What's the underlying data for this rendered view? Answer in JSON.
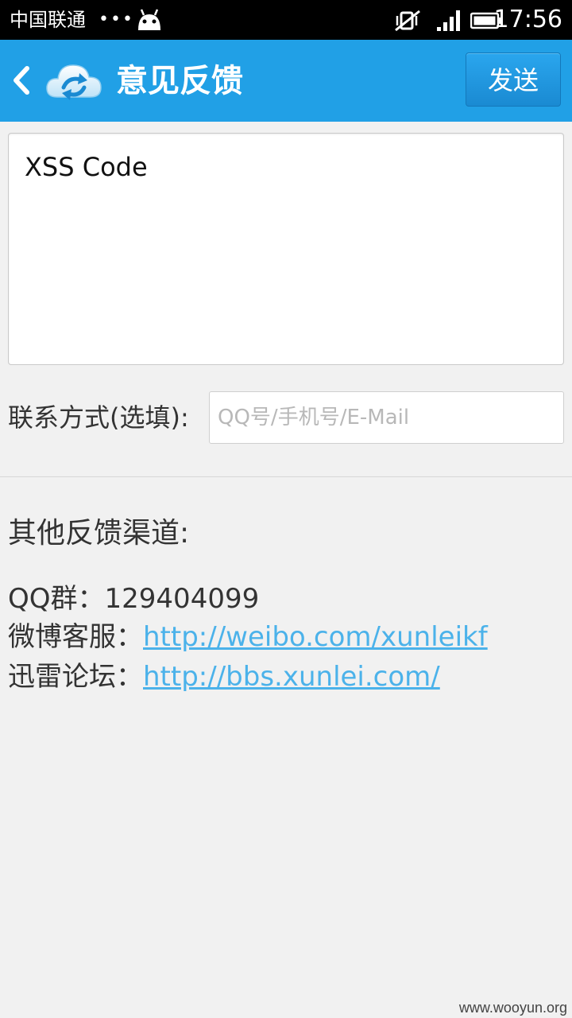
{
  "status_bar": {
    "carrier": "中国联通",
    "dots": "•••",
    "time": "17:56"
  },
  "title_bar": {
    "back_icon": "chevron-left-icon",
    "logo_icon": "cloud-refresh-icon",
    "title": "意见反馈",
    "send_label": "发送",
    "color": "#21a0e6"
  },
  "feedback": {
    "text": "XSS Code"
  },
  "contact": {
    "label": "联系方式(选填):",
    "placeholder": "QQ号/手机号/E-Mail"
  },
  "other_channels": {
    "title": "其他反馈渠道:",
    "items": [
      {
        "label": "QQ群：",
        "value": "129404099"
      },
      {
        "label": "微博客服：",
        "value": "http://weibo.com/xunleikf"
      },
      {
        "label": "迅雷论坛：",
        "value": "http://bbs.xunlei.com/"
      }
    ],
    "link_color": "#4bb2ea"
  },
  "watermark": "www.wooyun.org"
}
